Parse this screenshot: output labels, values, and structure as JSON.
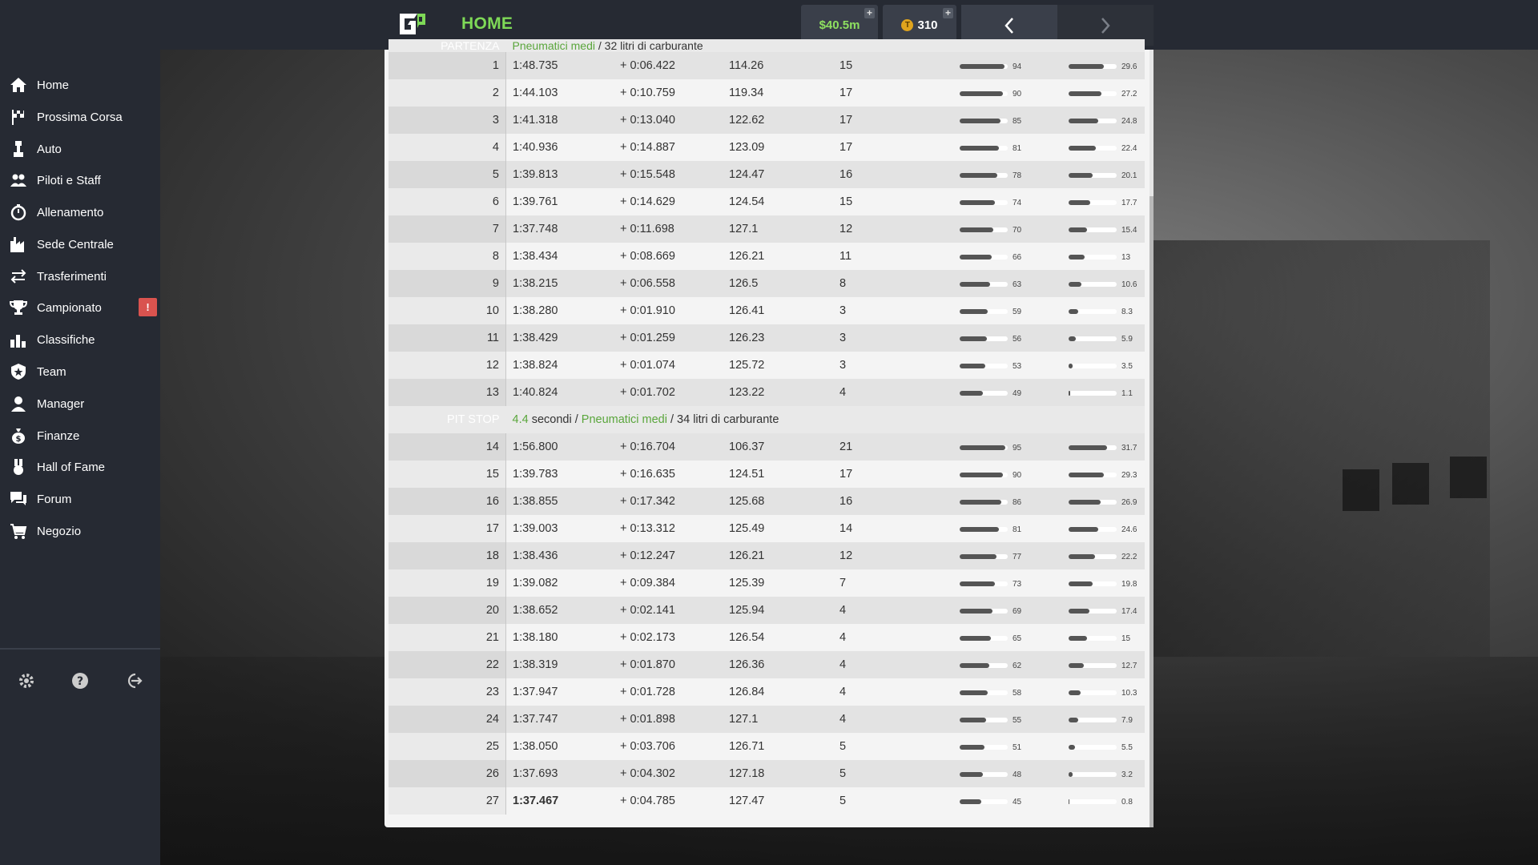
{
  "header": {
    "title": "HOME",
    "money": "$40.5m",
    "tokens": "310"
  },
  "sidebar": {
    "items": [
      {
        "label": "Home",
        "icon": "home-icon"
      },
      {
        "label": "Prossima Corsa",
        "icon": "flag-icon"
      },
      {
        "label": "Auto",
        "icon": "car-icon"
      },
      {
        "label": "Piloti e Staff",
        "icon": "people-icon"
      },
      {
        "label": "Allenamento",
        "icon": "stopwatch-icon"
      },
      {
        "label": "Sede Centrale",
        "icon": "factory-icon"
      },
      {
        "label": "Trasferimenti",
        "icon": "transfer-arrows-icon"
      },
      {
        "label": "Campionato",
        "icon": "trophy-icon",
        "badge": "!"
      },
      {
        "label": "Classifiche",
        "icon": "bar-chart-icon"
      },
      {
        "label": "Team",
        "icon": "shield-star-icon"
      },
      {
        "label": "Manager",
        "icon": "person-icon"
      },
      {
        "label": "Finanze",
        "icon": "money-bag-icon"
      },
      {
        "label": "Hall of Fame",
        "icon": "medal-icon"
      },
      {
        "label": "Forum",
        "icon": "chat-icon"
      },
      {
        "label": "Negozio",
        "icon": "cart-icon"
      }
    ],
    "footer_icons": [
      "gear-icon",
      "help-icon",
      "logout-icon"
    ]
  },
  "stints": [
    {
      "label": "PARTENZA",
      "tyre": "Pneumatici medi",
      "fuel": "/ 32 litri di carburante",
      "laps": [
        {
          "lap": "1",
          "time": "1:48.735",
          "gap": "+ 0:06.422",
          "speed": "114.26",
          "pos": "15",
          "fuel": 94,
          "tyre": 29.6
        },
        {
          "lap": "2",
          "time": "1:44.103",
          "gap": "+ 0:10.759",
          "speed": "119.34",
          "pos": "17",
          "fuel": 90,
          "tyre": 27.2
        },
        {
          "lap": "3",
          "time": "1:41.318",
          "gap": "+ 0:13.040",
          "speed": "122.62",
          "pos": "17",
          "fuel": 85,
          "tyre": 24.8
        },
        {
          "lap": "4",
          "time": "1:40.936",
          "gap": "+ 0:14.887",
          "speed": "123.09",
          "pos": "17",
          "fuel": 81,
          "tyre": 22.4
        },
        {
          "lap": "5",
          "time": "1:39.813",
          "gap": "+ 0:15.548",
          "speed": "124.47",
          "pos": "16",
          "fuel": 78,
          "tyre": 20.1
        },
        {
          "lap": "6",
          "time": "1:39.761",
          "gap": "+ 0:14.629",
          "speed": "124.54",
          "pos": "15",
          "fuel": 74,
          "tyre": 17.7
        },
        {
          "lap": "7",
          "time": "1:37.748",
          "gap": "+ 0:11.698",
          "speed": "127.1",
          "pos": "12",
          "fuel": 70,
          "tyre": 15.4
        },
        {
          "lap": "8",
          "time": "1:38.434",
          "gap": "+ 0:08.669",
          "speed": "126.21",
          "pos": "11",
          "fuel": 66,
          "tyre": 13
        },
        {
          "lap": "9",
          "time": "1:38.215",
          "gap": "+ 0:06.558",
          "speed": "126.5",
          "pos": "8",
          "fuel": 63,
          "tyre": 10.6
        },
        {
          "lap": "10",
          "time": "1:38.280",
          "gap": "+ 0:01.910",
          "speed": "126.41",
          "pos": "3",
          "fuel": 59,
          "tyre": 8.3
        },
        {
          "lap": "11",
          "time": "1:38.429",
          "gap": "+ 0:01.259",
          "speed": "126.23",
          "pos": "3",
          "fuel": 56,
          "tyre": 5.9
        },
        {
          "lap": "12",
          "time": "1:38.824",
          "gap": "+ 0:01.074",
          "speed": "125.72",
          "pos": "3",
          "fuel": 53,
          "tyre": 3.5
        },
        {
          "lap": "13",
          "time": "1:40.824",
          "gap": "+ 0:01.702",
          "speed": "123.22",
          "pos": "4",
          "fuel": 49,
          "tyre": 1.1
        }
      ]
    },
    {
      "label": "PIT STOP",
      "pit_time": "4.4",
      "pit_unit": "secondi /",
      "tyre": "Pneumatici medi",
      "fuel": "/ 34 litri di carburante",
      "laps": [
        {
          "lap": "14",
          "time": "1:56.800",
          "gap": "+ 0:16.704",
          "speed": "106.37",
          "pos": "21",
          "fuel": 95,
          "tyre": 31.7
        },
        {
          "lap": "15",
          "time": "1:39.783",
          "gap": "+ 0:16.635",
          "speed": "124.51",
          "pos": "17",
          "fuel": 90,
          "tyre": 29.3
        },
        {
          "lap": "16",
          "time": "1:38.855",
          "gap": "+ 0:17.342",
          "speed": "125.68",
          "pos": "16",
          "fuel": 86,
          "tyre": 26.9
        },
        {
          "lap": "17",
          "time": "1:39.003",
          "gap": "+ 0:13.312",
          "speed": "125.49",
          "pos": "14",
          "fuel": 81,
          "tyre": 24.6
        },
        {
          "lap": "18",
          "time": "1:38.436",
          "gap": "+ 0:12.247",
          "speed": "126.21",
          "pos": "12",
          "fuel": 77,
          "tyre": 22.2
        },
        {
          "lap": "19",
          "time": "1:39.082",
          "gap": "+ 0:09.384",
          "speed": "125.39",
          "pos": "7",
          "fuel": 73,
          "tyre": 19.8
        },
        {
          "lap": "20",
          "time": "1:38.652",
          "gap": "+ 0:02.141",
          "speed": "125.94",
          "pos": "4",
          "fuel": 69,
          "tyre": 17.4
        },
        {
          "lap": "21",
          "time": "1:38.180",
          "gap": "+ 0:02.173",
          "speed": "126.54",
          "pos": "4",
          "fuel": 65,
          "tyre": 15
        },
        {
          "lap": "22",
          "time": "1:38.319",
          "gap": "+ 0:01.870",
          "speed": "126.36",
          "pos": "4",
          "fuel": 62,
          "tyre": 12.7
        },
        {
          "lap": "23",
          "time": "1:37.947",
          "gap": "+ 0:01.728",
          "speed": "126.84",
          "pos": "4",
          "fuel": 58,
          "tyre": 10.3
        },
        {
          "lap": "24",
          "time": "1:37.747",
          "gap": "+ 0:01.898",
          "speed": "127.1",
          "pos": "4",
          "fuel": 55,
          "tyre": 7.9
        },
        {
          "lap": "25",
          "time": "1:38.050",
          "gap": "+ 0:03.706",
          "speed": "126.71",
          "pos": "5",
          "fuel": 51,
          "tyre": 5.5
        },
        {
          "lap": "26",
          "time": "1:37.693",
          "gap": "+ 0:04.302",
          "speed": "127.18",
          "pos": "5",
          "fuel": 48,
          "tyre": 3.2
        },
        {
          "lap": "27",
          "time": "1:37.467",
          "gap": "+ 0:04.785",
          "speed": "127.47",
          "pos": "5",
          "fuel": 45,
          "tyre": 0.8,
          "best": true
        }
      ]
    }
  ],
  "colors": {
    "accent_green": "#7ed957",
    "tyre_green": "#5aa63c",
    "best_lap_green": "#3a8f2e",
    "sidebar_bg": "#262a33",
    "badge_red": "#d9534f"
  }
}
